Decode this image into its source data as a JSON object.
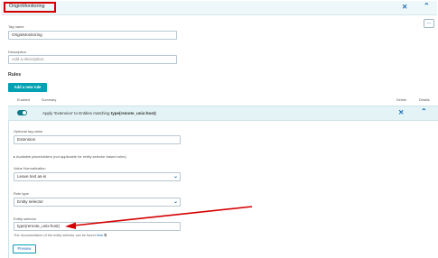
{
  "header": {
    "title": "OriginMonitoring",
    "close_icon": "close-icon",
    "collapse_icon": "chevron-up-icon"
  },
  "more_menu": {
    "label": "..."
  },
  "tag_name": {
    "label": "Tag name",
    "value": "OriginMonitoring"
  },
  "description": {
    "label": "Description",
    "placeholder": "Add a description"
  },
  "rules": {
    "heading": "Rules",
    "add_button": "Add a new rule",
    "columns": {
      "enabled": "Enabled",
      "summary": "Summary",
      "delete": "Delete",
      "details": "Details"
    },
    "row": {
      "enabled": true,
      "summary_prefix": "Apply 'Extension' to Entities matching ",
      "summary_bold": "type(remote_unix:host)"
    }
  },
  "rule_detail": {
    "optional_tag_value": {
      "label": "Optional tag value",
      "value": "Extension"
    },
    "placeholders_expander": "Available placeholders (not applicable for entity selector based rules)",
    "value_normalization": {
      "label": "Value Normalization",
      "selected": "Leave text as-is"
    },
    "rule_type": {
      "label": "Rule type",
      "selected": "Entity selector"
    },
    "entity_selector": {
      "label": "Entity selector",
      "value": "type(remote_unix:host)"
    },
    "help_text": "The documentation of the entity selector can be found ",
    "help_link": "here",
    "preview_button": "Preview"
  },
  "colors": {
    "accent": "#00a1b2",
    "link": "#1a6bb5",
    "annotation_red": "#d40000"
  }
}
